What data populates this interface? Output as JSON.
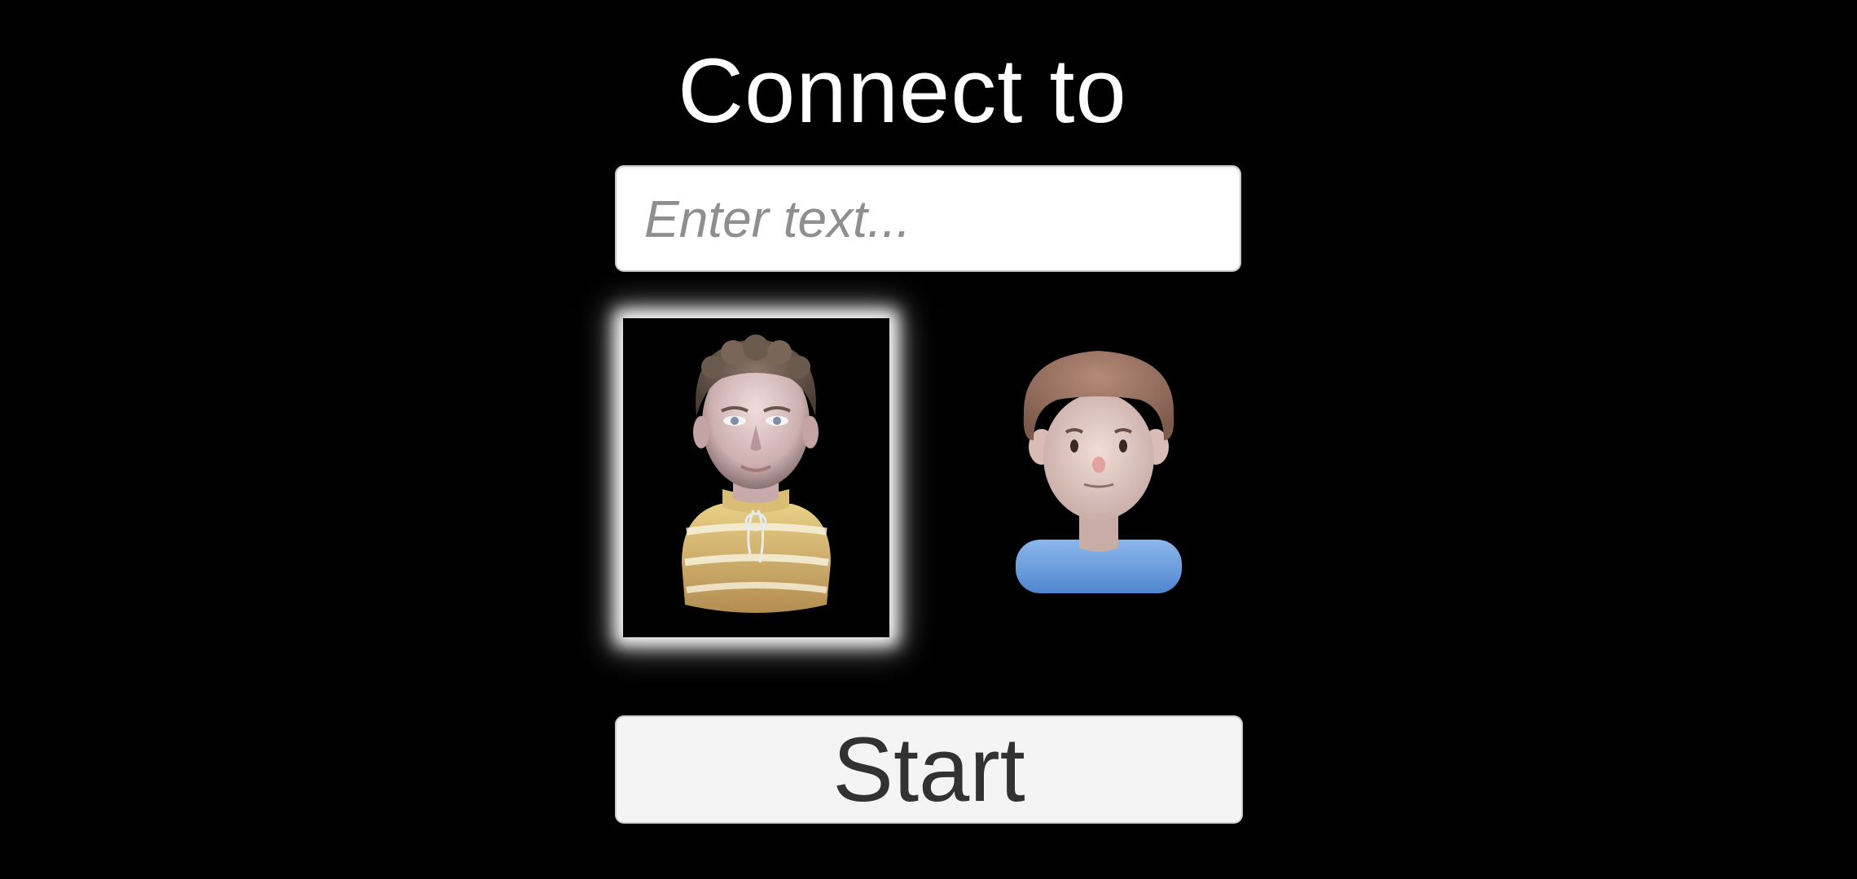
{
  "window": {
    "title": "Connect to"
  },
  "connect": {
    "input_placeholder": "Enter text...",
    "input_value": ""
  },
  "avatars": [
    {
      "name": "realistic-avatar",
      "selected": true
    },
    {
      "name": "cartoon-avatar",
      "selected": false
    }
  ],
  "actions": {
    "start_label": "Start"
  },
  "colors": {
    "background": "#000000",
    "input_background": "#ffffff",
    "placeholder": "#8f8f8f",
    "button_background": "#f4f4f4",
    "button_text": "#323232",
    "selection_glow": "#ffffff"
  }
}
